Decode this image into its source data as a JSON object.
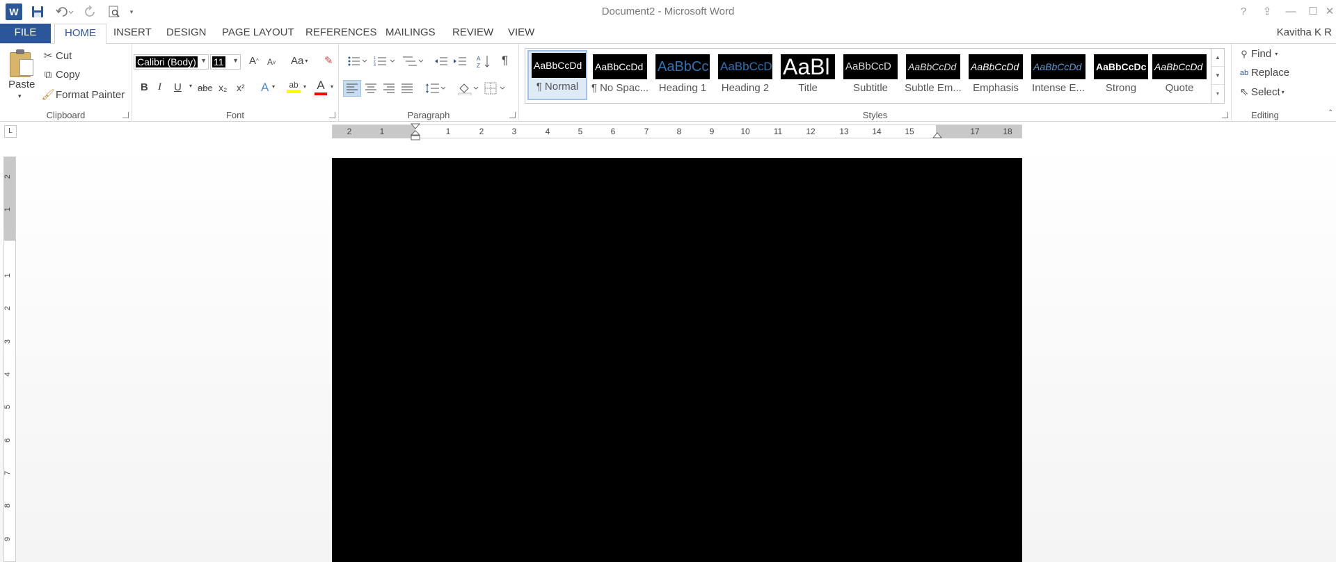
{
  "window": {
    "title": "Document2 - Microsoft Word",
    "logo_letter": "W",
    "controls": {
      "help": "?",
      "ribbon_display": "⇪",
      "minimize": "—",
      "maximize": "☐",
      "close": "✕"
    }
  },
  "quick_access": {
    "save_icon": "save-icon",
    "undo_icon": "undo-icon",
    "redo_icon": "redo-icon",
    "print_preview_icon": "print-preview-icon"
  },
  "tabs": [
    {
      "label": "FILE"
    },
    {
      "label": "HOME"
    },
    {
      "label": "INSERT"
    },
    {
      "label": "DESIGN"
    },
    {
      "label": "PAGE LAYOUT"
    },
    {
      "label": "REFERENCES"
    },
    {
      "label": "MAILINGS"
    },
    {
      "label": "REVIEW"
    },
    {
      "label": "VIEW"
    }
  ],
  "user": {
    "name": "Kavitha K R"
  },
  "clipboard": {
    "label": "Clipboard",
    "paste": "Paste",
    "cut": "Cut",
    "copy": "Copy",
    "format_painter": "Format Painter"
  },
  "font": {
    "label": "Font",
    "family": "Calibri (Body)",
    "size": "11",
    "grow": "A",
    "shrink": "A",
    "change_case": "Aa",
    "bold": "B",
    "italic": "I",
    "underline": "U",
    "strikethrough": "abc",
    "subscript": "x₂",
    "superscript": "x²",
    "text_effects": "A",
    "highlight": "ab",
    "font_color": "A"
  },
  "paragraph": {
    "label": "Paragraph",
    "show_marks": "¶"
  },
  "styles": {
    "label": "Styles",
    "items": [
      {
        "sample": "AaBbCcDd",
        "name": "¶ Normal"
      },
      {
        "sample": "AaBbCcDd",
        "name": "¶ No Spac..."
      },
      {
        "sample": "AaBbCc",
        "name": "Heading 1"
      },
      {
        "sample": "AaBbCcD",
        "name": "Heading 2"
      },
      {
        "sample": "AaBl",
        "name": "Title"
      },
      {
        "sample": "AaBbCcD",
        "name": "Subtitle"
      },
      {
        "sample": "AaBbCcDd",
        "name": "Subtle Em..."
      },
      {
        "sample": "AaBbCcDd",
        "name": "Emphasis"
      },
      {
        "sample": "AaBbCcDd",
        "name": "Intense E..."
      },
      {
        "sample": "AaBbCcDc",
        "name": "Strong"
      },
      {
        "sample": "AaBbCcDd",
        "name": "Quote"
      }
    ]
  },
  "editing": {
    "label": "Editing",
    "find": "Find",
    "replace": "Replace",
    "select": "Select"
  },
  "ruler": {
    "tab_selector": "L",
    "h_numbers": [
      "2",
      "1",
      "1",
      "2",
      "3",
      "4",
      "5",
      "6",
      "7",
      "8",
      "9",
      "10",
      "11",
      "12",
      "13",
      "14",
      "15",
      "17",
      "18"
    ],
    "v_numbers": [
      "2",
      "1",
      "1",
      "2",
      "3",
      "4",
      "5",
      "6",
      "7",
      "8",
      "9"
    ]
  },
  "colors": {
    "accent": "#2b579a",
    "page": "#000000",
    "highlight": "#ffff00",
    "font_color": "#ff0000",
    "heading_blue": "#2e74b5"
  }
}
